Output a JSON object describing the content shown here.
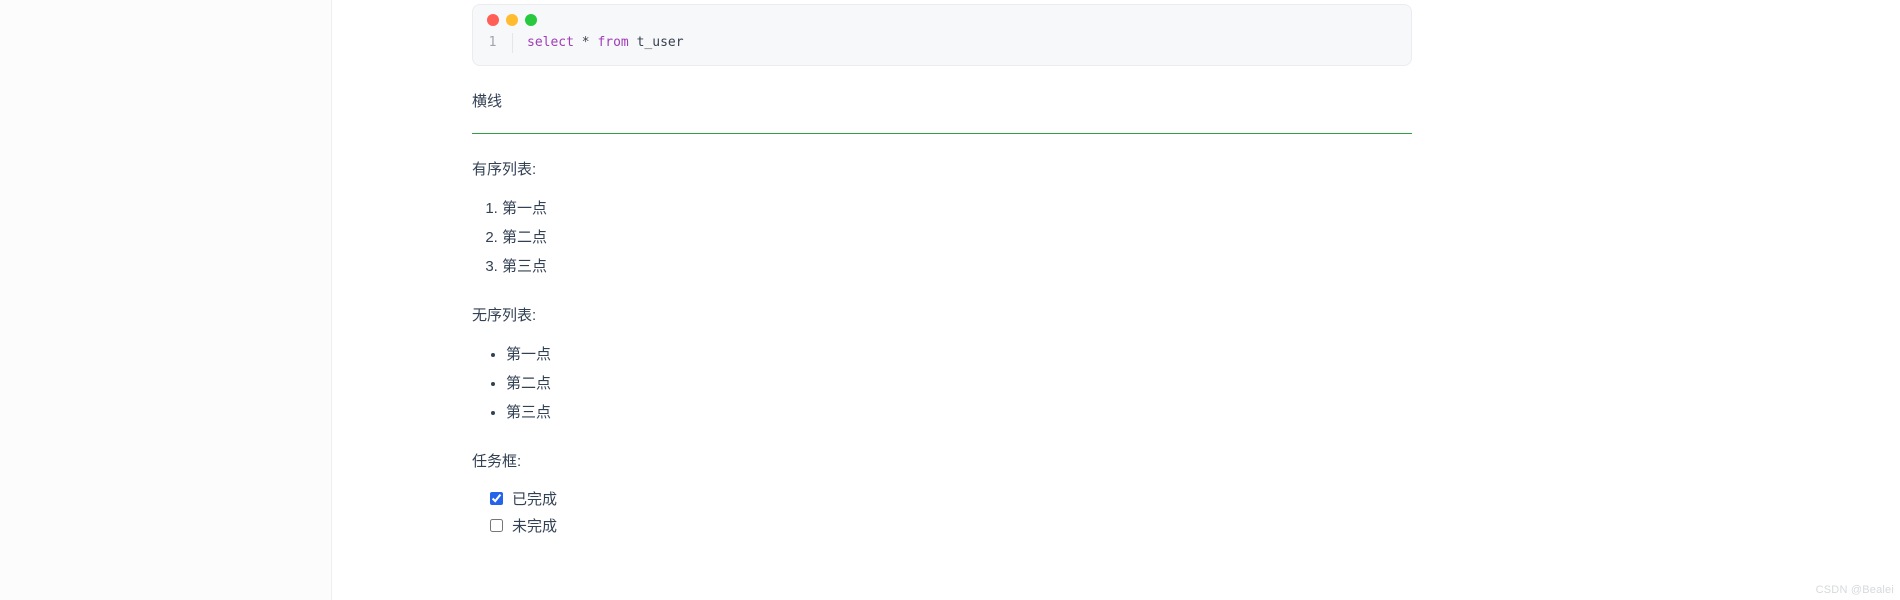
{
  "code": {
    "line_number": "1",
    "keyword_select": "select",
    "star": "*",
    "keyword_from": "from",
    "table": "t_user"
  },
  "sections": {
    "hr_label": "横线",
    "ordered_label": "有序列表:",
    "unordered_label": "无序列表:",
    "task_label": "任务框:"
  },
  "ordered_items": [
    "第一点",
    "第二点",
    "第三点"
  ],
  "unordered_items": [
    "第一点",
    "第二点",
    "第三点"
  ],
  "tasks": [
    {
      "label": "已完成",
      "checked": true
    },
    {
      "label": "未完成",
      "checked": false
    }
  ],
  "watermark": "CSDN @Bealei"
}
